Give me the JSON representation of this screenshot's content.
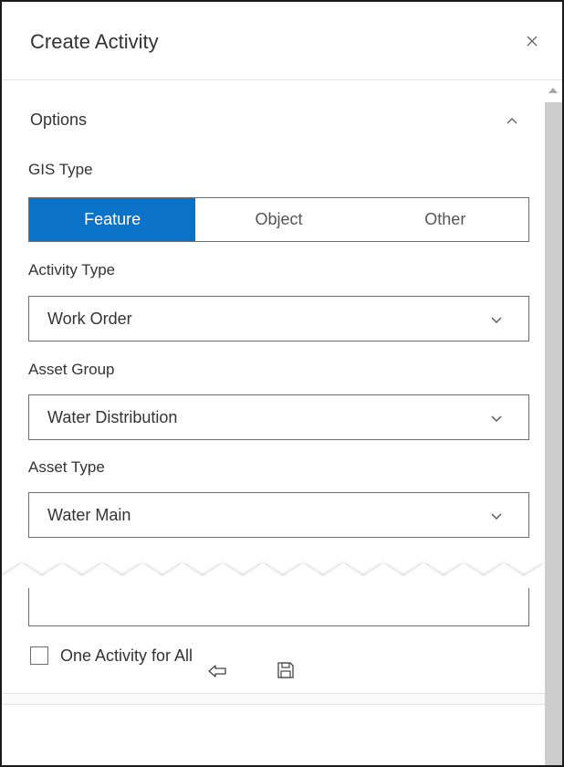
{
  "header": {
    "title": "Create Activity",
    "close_icon": "close-icon"
  },
  "options": {
    "title": "Options",
    "gis_type": {
      "label": "GIS Type",
      "segments": [
        {
          "label": "Feature",
          "selected": true
        },
        {
          "label": "Object",
          "selected": false
        },
        {
          "label": "Other",
          "selected": false
        }
      ]
    },
    "activity_type": {
      "label": "Activity Type",
      "value": "Work Order"
    },
    "asset_group": {
      "label": "Asset Group",
      "value": "Water Distribution"
    },
    "asset_type": {
      "label": "Asset Type",
      "value": "Water Main"
    },
    "one_activity": {
      "label": "One Activity for All",
      "checked": false
    }
  },
  "footer": {
    "back_icon": "back-arrow-icon",
    "save_icon": "save-icon"
  },
  "colors": {
    "accent": "#0a72c7",
    "border": "#6e6e6e",
    "text": "#333333",
    "scroll_thumb": "#cdcdcd"
  }
}
